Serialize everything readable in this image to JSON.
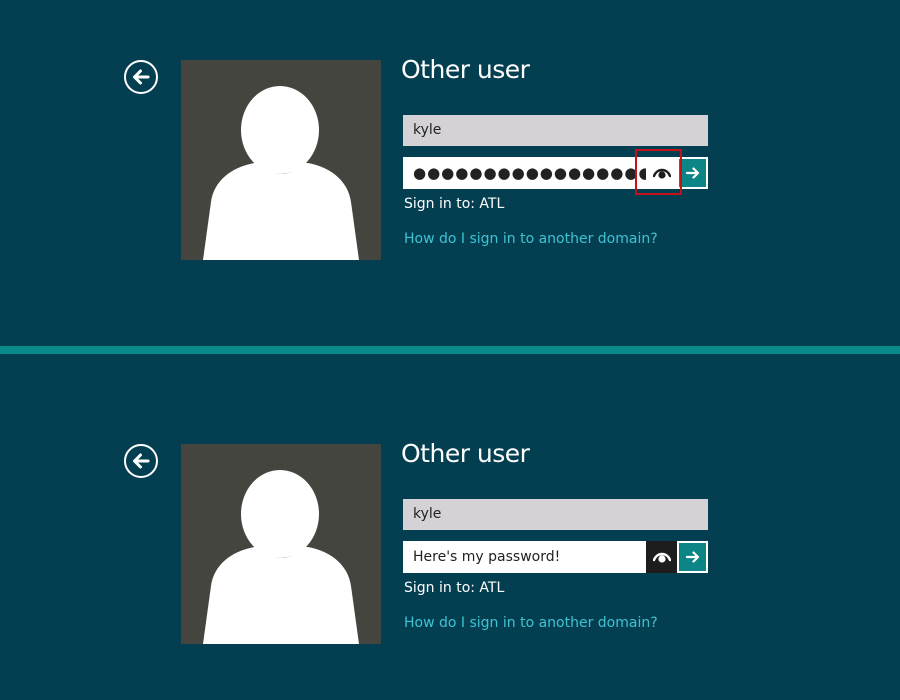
{
  "panels": [
    {
      "title": "Other user",
      "username": "kyle",
      "password_display": "●●●●●●●●●●●●●●●●●●●",
      "password_masked": true,
      "reveal_highlighted": true,
      "signin_label": "Sign in to: ATL",
      "domain_link": "How do I sign in to another domain?"
    },
    {
      "title": "Other user",
      "username": "kyle",
      "password_display": "Here's my password!",
      "password_masked": false,
      "reveal_highlighted": false,
      "signin_label": "Sign in to: ATL",
      "domain_link": "How do I sign in to another domain?"
    }
  ],
  "icons": {
    "back": "back-arrow-icon",
    "avatar": "user-silhouette-icon",
    "reveal": "eye-icon",
    "submit": "arrow-right-icon"
  },
  "colors": {
    "background": "#043f51",
    "divider": "#0a8a8a",
    "accent": "#0b8585",
    "link": "#3fc3d3",
    "highlight": "#c4121a"
  }
}
